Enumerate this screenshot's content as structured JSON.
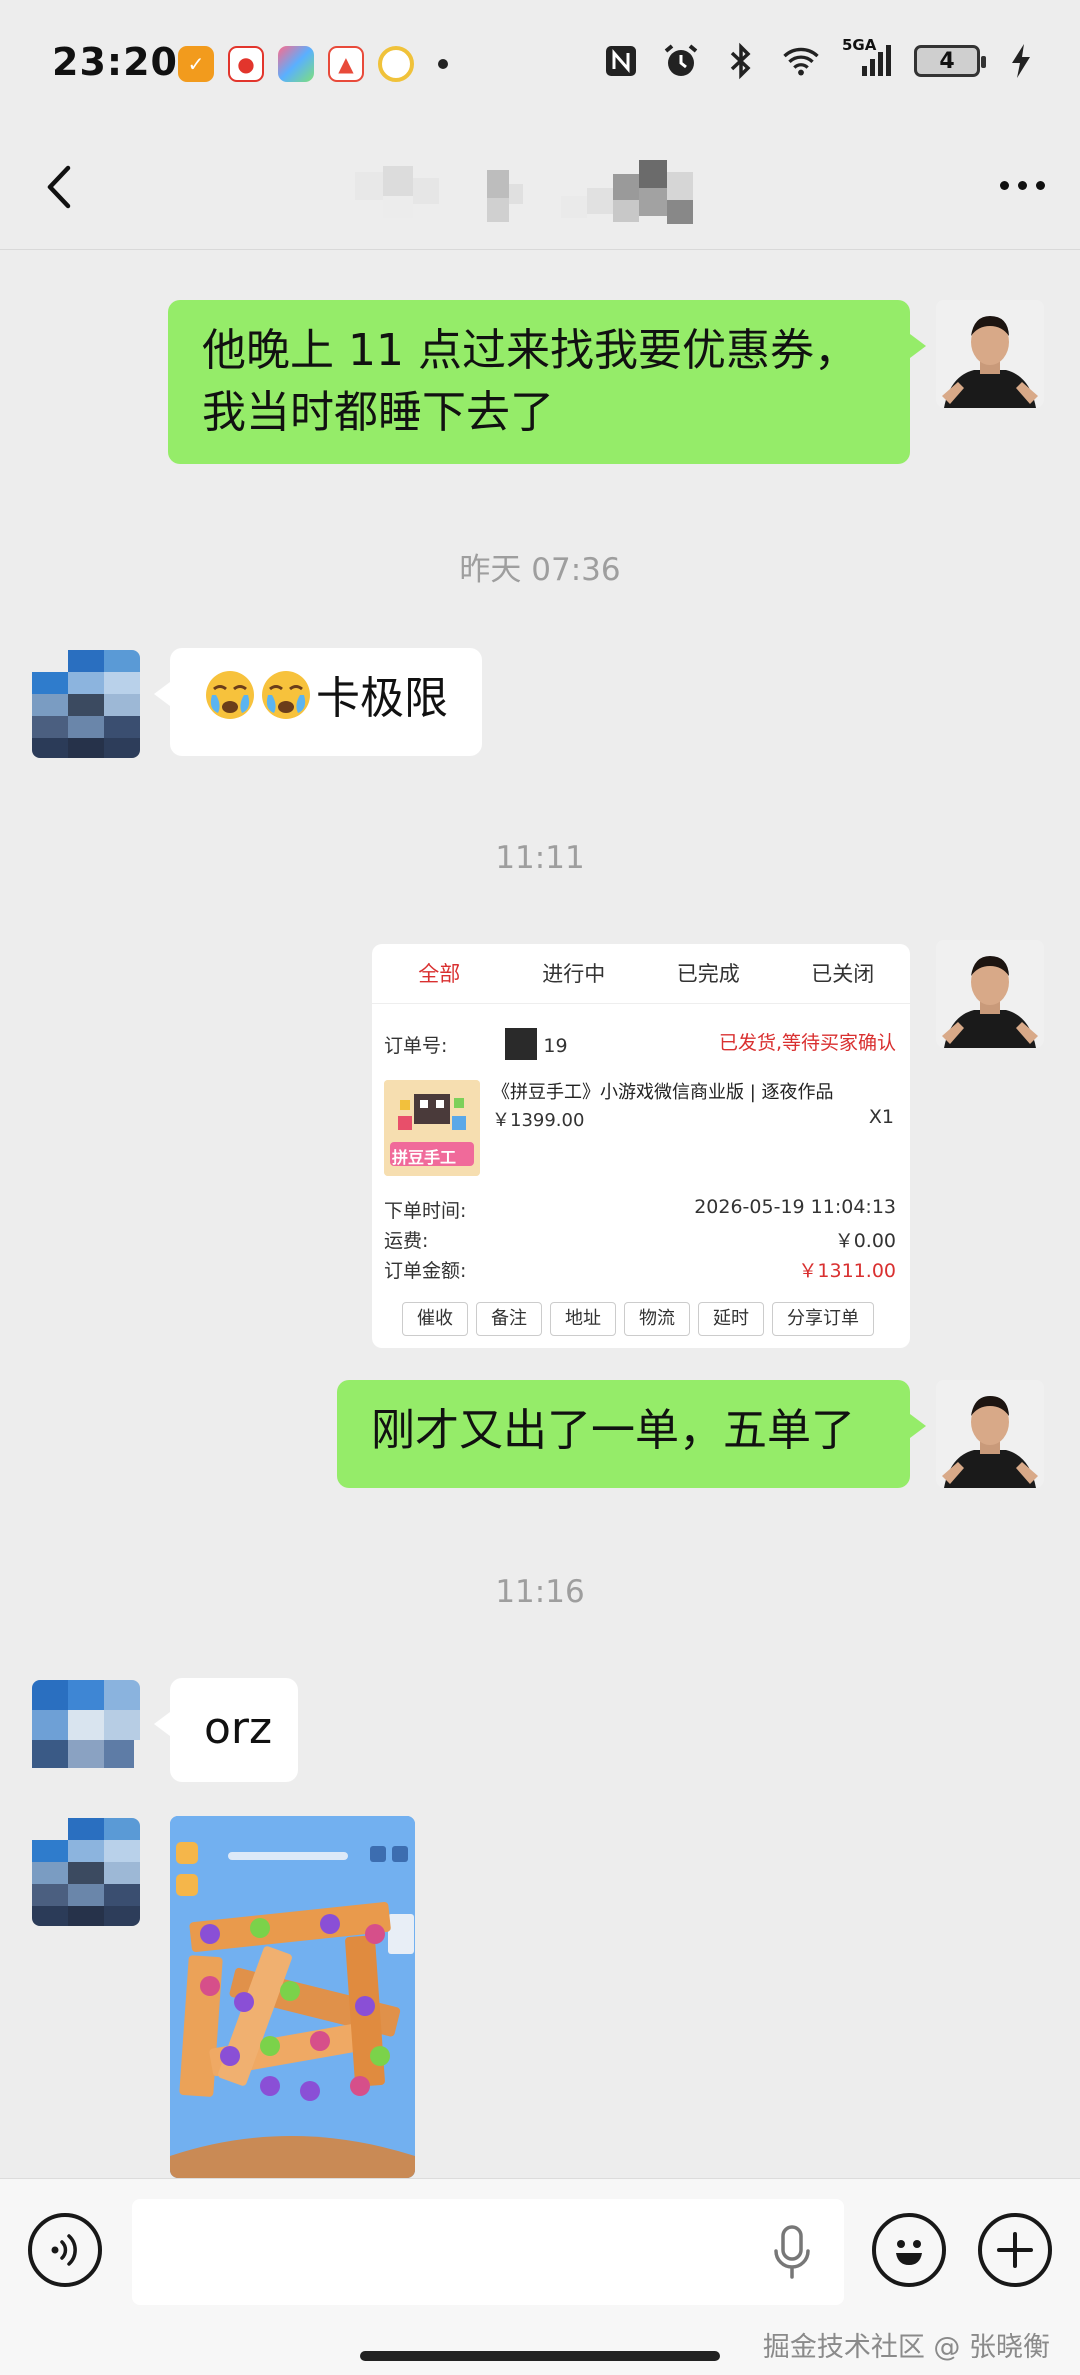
{
  "status_bar": {
    "time": "23:20",
    "app_icons": [
      "app-icon-1",
      "weibo-icon",
      "app-icon-3",
      "app-icon-4",
      "app-icon-5"
    ],
    "network": "5GA",
    "battery": "4"
  },
  "chat": {
    "messages": [
      {
        "sender": "me",
        "text": "他晚上 11 点过来找我要优惠券，我当时都睡下去了"
      },
      {
        "timestamp": "昨天 07:36"
      },
      {
        "sender": "them",
        "emojis": [
          "crying-emoji",
          "crying-emoji"
        ],
        "text": "卡极限"
      },
      {
        "timestamp": "11:11"
      },
      {
        "sender": "me",
        "type": "order-screenshot"
      },
      {
        "sender": "me",
        "text": "刚才又出了一单，五单了"
      },
      {
        "timestamp": "11:16"
      },
      {
        "sender": "them",
        "text": "orz"
      },
      {
        "sender": "them",
        "type": "game-screenshot"
      }
    ]
  },
  "order_card": {
    "tabs": [
      "全部",
      "进行中",
      "已完成",
      "已关闭"
    ],
    "order_no_label": "订单号:",
    "order_no_suffix": "19",
    "status": "已发货,等待买家确认",
    "product_name": "《拼豆手工》小游戏微信商业版 | 逐夜作品",
    "product_price": "￥1399.00",
    "quantity": "X1",
    "thumb_text": "拼豆手工",
    "order_time_label": "下单时间:",
    "order_time": "2026-05-19 11:04:13",
    "shipping_label": "运费:",
    "shipping": "￥0.00",
    "amount_label": "订单金额:",
    "amount": "￥1311.00",
    "buttons": [
      "催收",
      "备注",
      "地址",
      "物流",
      "延时",
      "分享订单"
    ]
  },
  "input_bar": {
    "placeholder": "",
    "watermark": "掘金技术社区 @ 张晓衡"
  },
  "colors": {
    "my_bubble": "#95ec69",
    "their_bubble": "#ffffff",
    "background": "#ededed",
    "accent_red": "#d93030"
  }
}
